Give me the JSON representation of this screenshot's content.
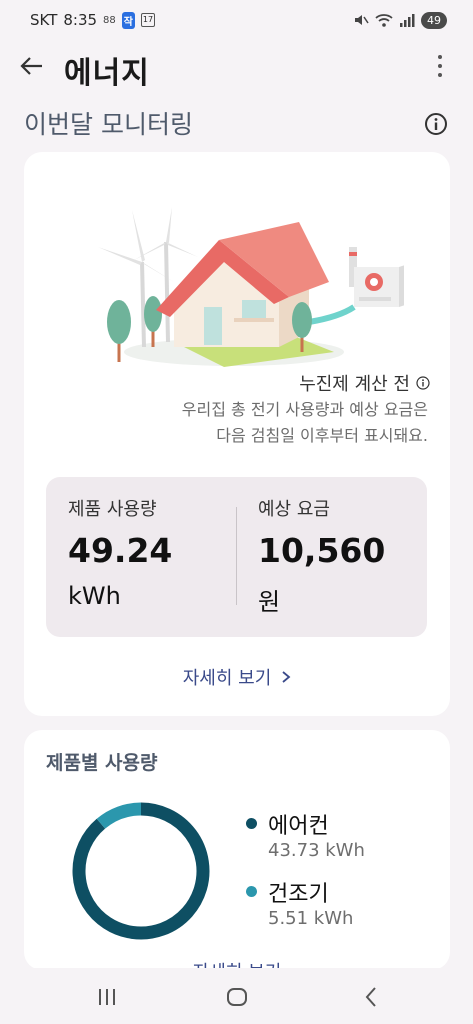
{
  "status_bar": {
    "carrier": "SKT",
    "time": "8:35",
    "mini_icon_text": "88",
    "badge_text": "작",
    "calendar_day": "17",
    "battery": "49"
  },
  "header": {
    "title": "에너지"
  },
  "section": {
    "title": "이번달 모니터링"
  },
  "monitor_card": {
    "note_title": "누진제 계산 전",
    "note_desc": "우리집 총 전기 사용량과 예상 요금은 다음 검침일 이후부터 표시돼요.",
    "usage": {
      "label": "제품 사용량",
      "value": "49.24",
      "unit": "kWh"
    },
    "charge": {
      "label": "예상 요금",
      "value": "10,560",
      "unit": "원"
    },
    "detail_link": "자세히 보기"
  },
  "product_card": {
    "title": "제품별 사용량",
    "items": [
      {
        "name": "에어컨",
        "value": "43.73 kWh",
        "color": "#0e4f63"
      },
      {
        "name": "건조기",
        "value": "5.51 kWh",
        "color": "#2b97ad"
      }
    ],
    "detail_link": "자세히 보기"
  },
  "colors": {
    "accent_link": "#3a4a8a",
    "donut_primary": "#0e4f63",
    "donut_secondary": "#2b97ad"
  },
  "chart_data": {
    "type": "pie",
    "categories": [
      "에어컨",
      "건조기"
    ],
    "values": [
      43.73,
      5.51
    ]
  }
}
